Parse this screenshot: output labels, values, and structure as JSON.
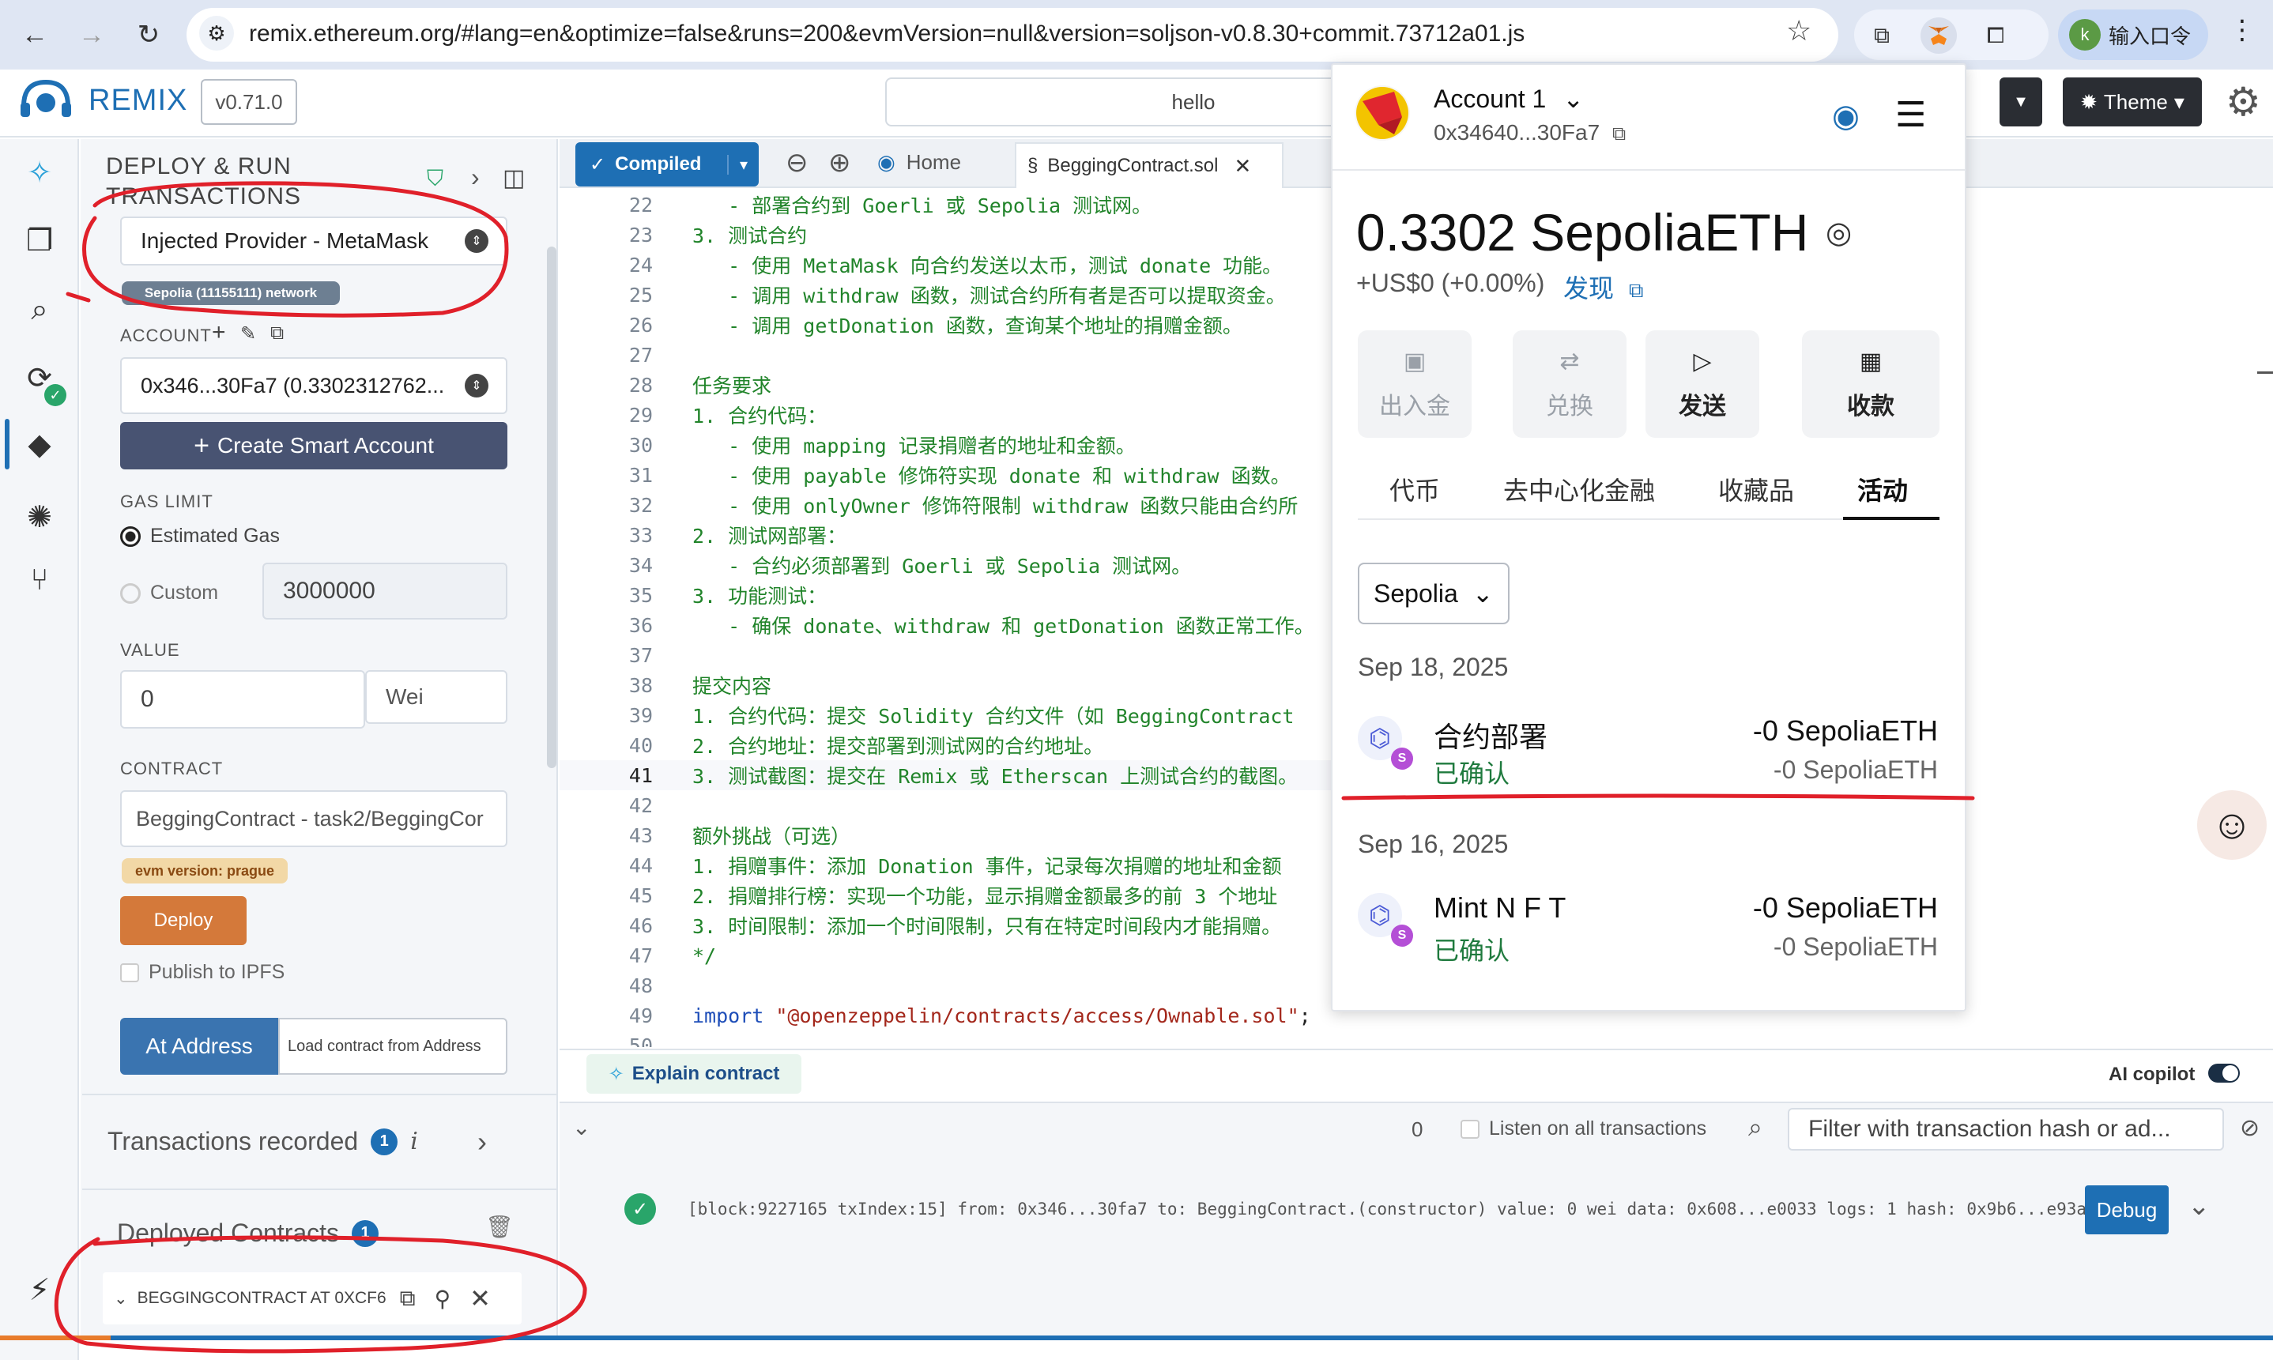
{
  "browser": {
    "url": "remix.ethereum.org/#lang=en&optimize=false&runs=200&evmVersion=null&version=soljson-v0.8.30+commit.73712a01.js",
    "profile_initial": "k",
    "profile_label": "输入口令"
  },
  "remix": {
    "name": "REMIX",
    "version": "v0.71.0",
    "hello": "hello",
    "theme_label": "Theme"
  },
  "deploy_panel": {
    "title": "DEPLOY & RUN TRANSACTIONS",
    "environment": "Injected Provider - MetaMask",
    "network_badge": "Sepolia (11155111) network",
    "account_label": "ACCOUNT",
    "account_value": "0x346...30Fa7 (0.3302312762...",
    "create_smart_account": "Create Smart Account",
    "gas_limit_label": "GAS LIMIT",
    "estimated_gas": "Estimated Gas",
    "custom": "Custom",
    "gas_value": "3000000",
    "value_label": "VALUE",
    "value": "0",
    "value_unit": "Wei",
    "contract_label": "CONTRACT",
    "contract_value": "BeggingContract - task2/BeggingCor",
    "evm_badge": "evm version: prague",
    "deploy": "Deploy",
    "publish_ipfs": "Publish to IPFS",
    "at_address": "At Address",
    "load_address": "Load contract from Address",
    "transactions_recorded": "Transactions recorded",
    "transactions_count": "1",
    "info_icon": "i",
    "deployed_contracts": "Deployed Contracts",
    "deployed_count": "1",
    "deployed_item": "BEGGINGCONTRACT AT 0XCF6"
  },
  "editor": {
    "compiled": "Compiled",
    "home_tab": "Home",
    "file_tab": "BeggingContract.sol",
    "current_line": "41",
    "lines": [
      {
        "n": "22",
        "text": "   - 部署合约到 Goerli 或 Sepolia 测试网。"
      },
      {
        "n": "23",
        "text": "3. 测试合约"
      },
      {
        "n": "24",
        "text": "   - 使用 MetaMask 向合约发送以太币，测试 donate 功能。"
      },
      {
        "n": "25",
        "text": "   - 调用 withdraw 函数，测试合约所有者是否可以提取资金。"
      },
      {
        "n": "26",
        "text": "   - 调用 getDonation 函数，查询某个地址的捐赠金额。"
      },
      {
        "n": "27",
        "text": ""
      },
      {
        "n": "28",
        "text": "任务要求"
      },
      {
        "n": "29",
        "text": "1. 合约代码："
      },
      {
        "n": "30",
        "text": "   - 使用 mapping 记录捐赠者的地址和金额。"
      },
      {
        "n": "31",
        "text": "   - 使用 payable 修饰符实现 donate 和 withdraw 函数。"
      },
      {
        "n": "32",
        "text": "   - 使用 onlyOwner 修饰符限制 withdraw 函数只能由合约所"
      },
      {
        "n": "33",
        "text": "2. 测试网部署："
      },
      {
        "n": "34",
        "text": "   - 合约必须部署到 Goerli 或 Sepolia 测试网。"
      },
      {
        "n": "35",
        "text": "3. 功能测试："
      },
      {
        "n": "36",
        "text": "   - 确保 donate、withdraw 和 getDonation 函数正常工作。"
      },
      {
        "n": "37",
        "text": ""
      },
      {
        "n": "38",
        "text": "提交内容"
      },
      {
        "n": "39",
        "text": "1. 合约代码：提交 Solidity 合约文件（如 BeggingContract"
      },
      {
        "n": "40",
        "text": "2. 合约地址：提交部署到测试网的合约地址。"
      },
      {
        "n": "41",
        "text": "3. 测试截图：提交在 Remix 或 Etherscan 上测试合约的截图。"
      },
      {
        "n": "42",
        "text": ""
      },
      {
        "n": "43",
        "text": "额外挑战（可选）"
      },
      {
        "n": "44",
        "text": "1. 捐赠事件：添加 Donation 事件，记录每次捐赠的地址和金额"
      },
      {
        "n": "45",
        "text": "2. 捐赠排行榜：实现一个功能，显示捐赠金额最多的前 3 个地址"
      },
      {
        "n": "46",
        "text": "3. 时间限制：添加一个时间限制，只有在特定时间段内才能捐赠。"
      },
      {
        "n": "47",
        "text": "*/"
      },
      {
        "n": "48",
        "text": ""
      },
      {
        "n": "49",
        "text": "import"
      },
      {
        "n": "50",
        "text": ""
      }
    ],
    "import_path": "\"@openzeppelin/contracts/access/Ownable.sol\"",
    "import_end": ";"
  },
  "terminal": {
    "explain_contract": "Explain contract",
    "ai_copilot": "AI copilot",
    "pending_count": "0",
    "listen_all": "Listen on all transactions",
    "filter_placeholder": "Filter with transaction hash or ad...",
    "tx_log": "[block:9227165 txIndex:15]  from: 0x346...30fa7 to: BeggingContract.(constructor) value: 0 wei data: 0x608...e0033 logs: 1 hash: 0x9b6...e93a5",
    "debug": "Debug"
  },
  "metamask": {
    "account_name": "Account 1",
    "address": "0x34640...30Fa7",
    "balance": "0.3302 SepoliaETH",
    "fiat": "+US$0 (+0.00%)",
    "discover": "发现",
    "actions": [
      {
        "label": "出入金",
        "icon": "card-icon",
        "dim": true
      },
      {
        "label": "兑换",
        "icon": "swap-icon",
        "dim": true
      },
      {
        "label": "发送",
        "icon": "send-icon",
        "dim": false
      },
      {
        "label": "收款",
        "icon": "qr-icon",
        "dim": false
      }
    ],
    "tabs": [
      "代币",
      "去中心化金融",
      "收藏品",
      "活动"
    ],
    "active_tab": "活动",
    "network": "Sepolia",
    "activity": [
      {
        "date": "Sep 18, 2025",
        "title": "合约部署",
        "status": "已确认",
        "amount": "-0 SepoliaETH",
        "amount_sub": "-0 SepoliaETH"
      },
      {
        "date": "Sep 16, 2025",
        "title": "Mint N F T",
        "status": "已确认",
        "amount": "-0 SepoliaETH",
        "amount_sub": "-0 SepoliaETH"
      }
    ]
  },
  "colors": {
    "remix_blue": "#1e6fb4",
    "deploy_orange": "#d4793a",
    "annotation_red": "#e0202a",
    "code_green": "#21842a"
  }
}
